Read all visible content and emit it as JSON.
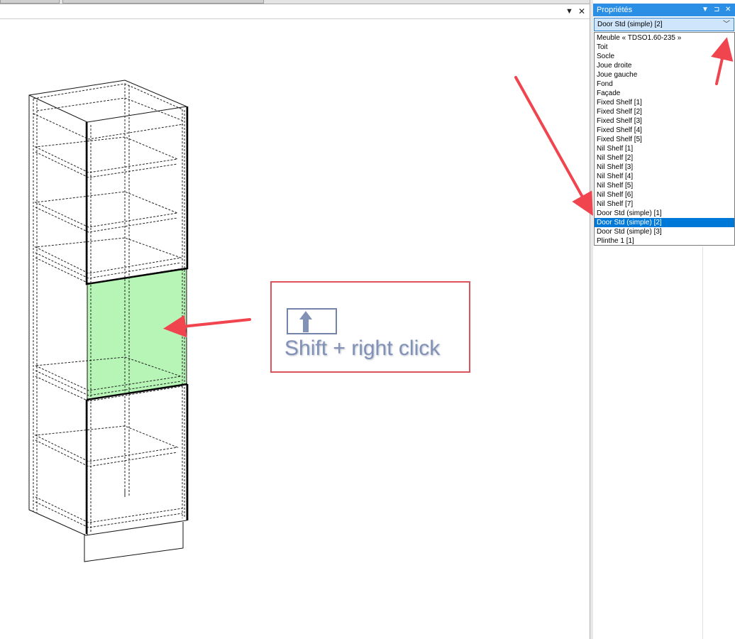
{
  "viewport": {
    "pin_icon": "dropdown-arrow-icon",
    "close_label": "✕"
  },
  "properties_panel": {
    "title": "Propriétés",
    "header_icons": [
      "dropdown-arrow-icon",
      "pin-icon",
      "close-icon"
    ],
    "pin_symbol": "⊐",
    "close_symbol": "✕",
    "combo_value": "Door Std (simple) [2]",
    "items": [
      "Meuble « TDSO1.60-235 »",
      "Toit",
      "Socle",
      "Joue droite",
      "Joue gauche",
      "Fond",
      "Façade",
      "Fixed Shelf [1]",
      "Fixed Shelf [2]",
      "Fixed Shelf [3]",
      "Fixed Shelf [4]",
      "Fixed Shelf [5]",
      "Nil Shelf [1]",
      "Nil Shelf [2]",
      "Nil Shelf [3]",
      "Nil Shelf [4]",
      "Nil Shelf [5]",
      "Nil Shelf [6]",
      "Nil Shelf [7]",
      "Door Std (simple) [1]",
      "Door Std (simple) [2]",
      "Door Std (simple) [3]",
      "Plinthe 1 [1]"
    ],
    "selected_item": "Door Std (simple) [2]"
  },
  "annotation": {
    "hint_text": "Shift + right click",
    "hint_icon": "shift-key-icon"
  },
  "colors": {
    "title_bar": "#2b8fe6",
    "selection": "#0078d7",
    "highlight_door": "#b6f5b6",
    "arrow": "#f0454f",
    "callout_border": "#e0525b"
  }
}
